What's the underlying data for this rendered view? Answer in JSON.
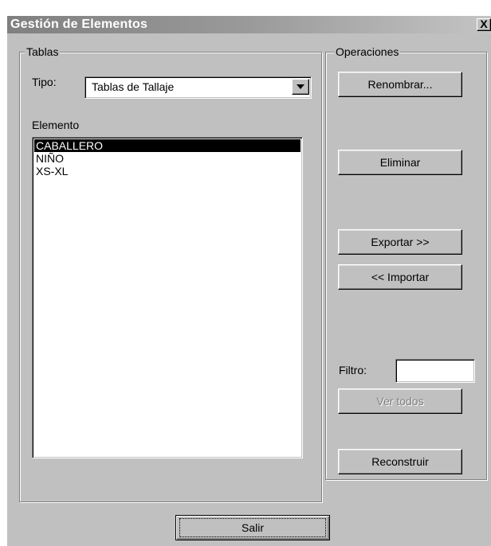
{
  "window": {
    "title": "Gestión de Elementos",
    "close_label": "X"
  },
  "tables_group": {
    "label": "Tablas",
    "tipo_label": "Tipo:",
    "tipo_value": "Tablas de Tallaje",
    "elemento_label": "Elemento",
    "items": [
      "CABALLERO",
      "NIÑO",
      "XS-XL"
    ],
    "selected_index": 0
  },
  "operations_group": {
    "label": "Operaciones",
    "rename_button": "Renombrar...",
    "delete_button": "Eliminar",
    "export_button": "Exportar >>",
    "import_button": "<< Importar",
    "filter_label": "Filtro:",
    "filter_value": "",
    "view_all_button": "Ver todos",
    "rebuild_button": "Reconstruir"
  },
  "footer": {
    "exit_button": "Salir"
  }
}
